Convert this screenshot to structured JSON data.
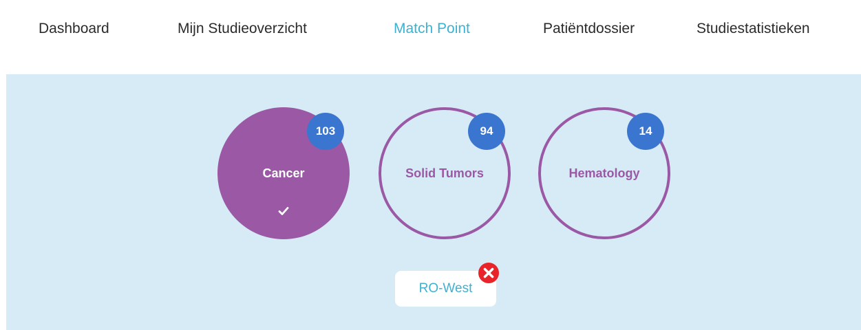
{
  "nav": {
    "items": [
      {
        "label": "Dashboard"
      },
      {
        "label": "Mijn Studieoverzicht"
      },
      {
        "label": "Match Point",
        "active": true
      },
      {
        "label": "Patiëntdossier"
      },
      {
        "label": "Studiestatistieken"
      }
    ],
    "active_color": "#3bb2d2"
  },
  "categories": [
    {
      "label": "Cancer",
      "count": "103",
      "selected": true,
      "icon": "check-icon"
    },
    {
      "label": "Solid Tumors",
      "count": "94",
      "selected": false
    },
    {
      "label": "Hematology",
      "count": "14",
      "selected": false
    }
  ],
  "filter_tag": {
    "label": "RO-West",
    "remove_icon": "close-icon"
  },
  "colors": {
    "category": "#9b58a5",
    "badge": "#3a75cf",
    "panel_background": "#d6ebf6",
    "remove": "#e8232a"
  }
}
